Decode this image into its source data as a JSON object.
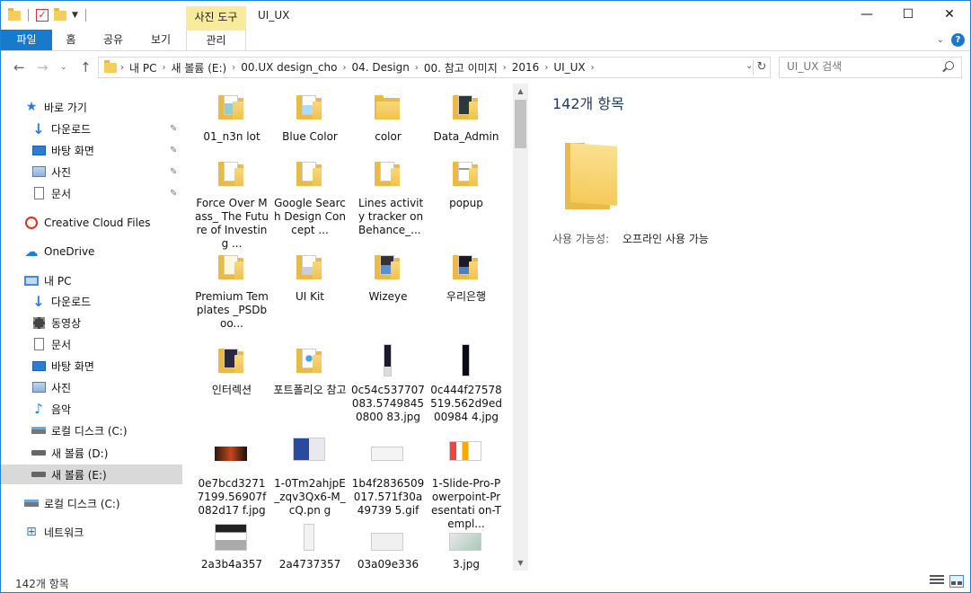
{
  "window": {
    "title": "UI_UX",
    "contextual_tab": "사진 도구",
    "min_glyph": "—",
    "max_glyph": "☐",
    "close_glyph": "✕"
  },
  "ribbon": {
    "tabs": [
      "파일",
      "홈",
      "공유",
      "보기",
      "관리"
    ],
    "help_glyph": "?"
  },
  "address": {
    "crumbs": [
      "내 PC",
      "새 볼륨 (E:)",
      "00.UX design_cho",
      "04. Design",
      "00. 참고 이미지",
      "2016",
      "UI_UX"
    ],
    "search_placeholder": "UI_UX 검색"
  },
  "nav": {
    "items": [
      {
        "label": "바로 가기",
        "icon": "star-icon"
      },
      {
        "label": "다운로드",
        "icon": "download-icon",
        "pinned": true
      },
      {
        "label": "바탕 화면",
        "icon": "desktop-icon",
        "pinned": true
      },
      {
        "label": "사진",
        "icon": "pictures-icon",
        "pinned": true
      },
      {
        "label": "문서",
        "icon": "documents-icon",
        "pinned": true
      },
      {
        "label": "Creative Cloud Files",
        "icon": "creative-cloud-icon"
      },
      {
        "label": "OneDrive",
        "icon": "onedrive-icon"
      },
      {
        "label": "내 PC",
        "icon": "pc-icon"
      },
      {
        "label": "다운로드",
        "icon": "download-icon"
      },
      {
        "label": "동영상",
        "icon": "video-icon"
      },
      {
        "label": "문서",
        "icon": "documents-icon"
      },
      {
        "label": "바탕 화면",
        "icon": "desktop-icon"
      },
      {
        "label": "사진",
        "icon": "pictures-icon"
      },
      {
        "label": "음악",
        "icon": "music-icon"
      },
      {
        "label": "로컬 디스크 (C:)",
        "icon": "drive-c-icon"
      },
      {
        "label": "새 볼륨 (D:)",
        "icon": "drive-icon"
      },
      {
        "label": "새 볼륨 (E:)",
        "icon": "drive-icon",
        "selected": true
      },
      {
        "label": "로컬 디스크 (C:)",
        "icon": "drive-c-icon"
      },
      {
        "label": "네트워크",
        "icon": "network-icon"
      }
    ]
  },
  "files": [
    {
      "name": "01_n3n lot",
      "kind": "folder"
    },
    {
      "name": "Blue Color",
      "kind": "folder"
    },
    {
      "name": "color",
      "kind": "folder"
    },
    {
      "name": "Data_Admin",
      "kind": "folder"
    },
    {
      "name": "Force Over Mass_ The Future of Investing ...",
      "kind": "folder"
    },
    {
      "name": "Google Search Design Concept ...",
      "kind": "folder"
    },
    {
      "name": "Lines activity tracker on Behance_...",
      "kind": "folder"
    },
    {
      "name": "popup",
      "kind": "folder"
    },
    {
      "name": "Premium Templates _PSDboo...",
      "kind": "folder"
    },
    {
      "name": "UI Kit",
      "kind": "folder"
    },
    {
      "name": "Wizeye",
      "kind": "folder"
    },
    {
      "name": "우리은행",
      "kind": "folder"
    },
    {
      "name": "인터렉션",
      "kind": "folder"
    },
    {
      "name": "포트폴리오 참고",
      "kind": "folder"
    },
    {
      "name": "0c54c537707083.57498450800 83.jpg",
      "kind": "image"
    },
    {
      "name": "0c444f27578519.562d9ed00984 4.jpg",
      "kind": "image"
    },
    {
      "name": "0e7bcd32717199.56907f082d17 f.jpg",
      "kind": "image"
    },
    {
      "name": "1-0Tm2ahjpE_zqv3Qx6-M_cQ.pn g",
      "kind": "image"
    },
    {
      "name": "1b4f2836509017.571f30a49739 5.gif",
      "kind": "image"
    },
    {
      "name": "1-Slide-Pro-Powerpoint-Presentati on-Templ...",
      "kind": "image"
    },
    {
      "name": "2a3b4a357",
      "kind": "image"
    },
    {
      "name": "2a4737357",
      "kind": "image"
    },
    {
      "name": "03a09e336",
      "kind": "image"
    },
    {
      "name": "3.jpg",
      "kind": "image"
    }
  ],
  "details": {
    "count": "142개 항목",
    "availability_label": "사용 가능성:",
    "availability_value": "오프라인 사용 가능"
  },
  "status": {
    "count": "142개 항목"
  }
}
